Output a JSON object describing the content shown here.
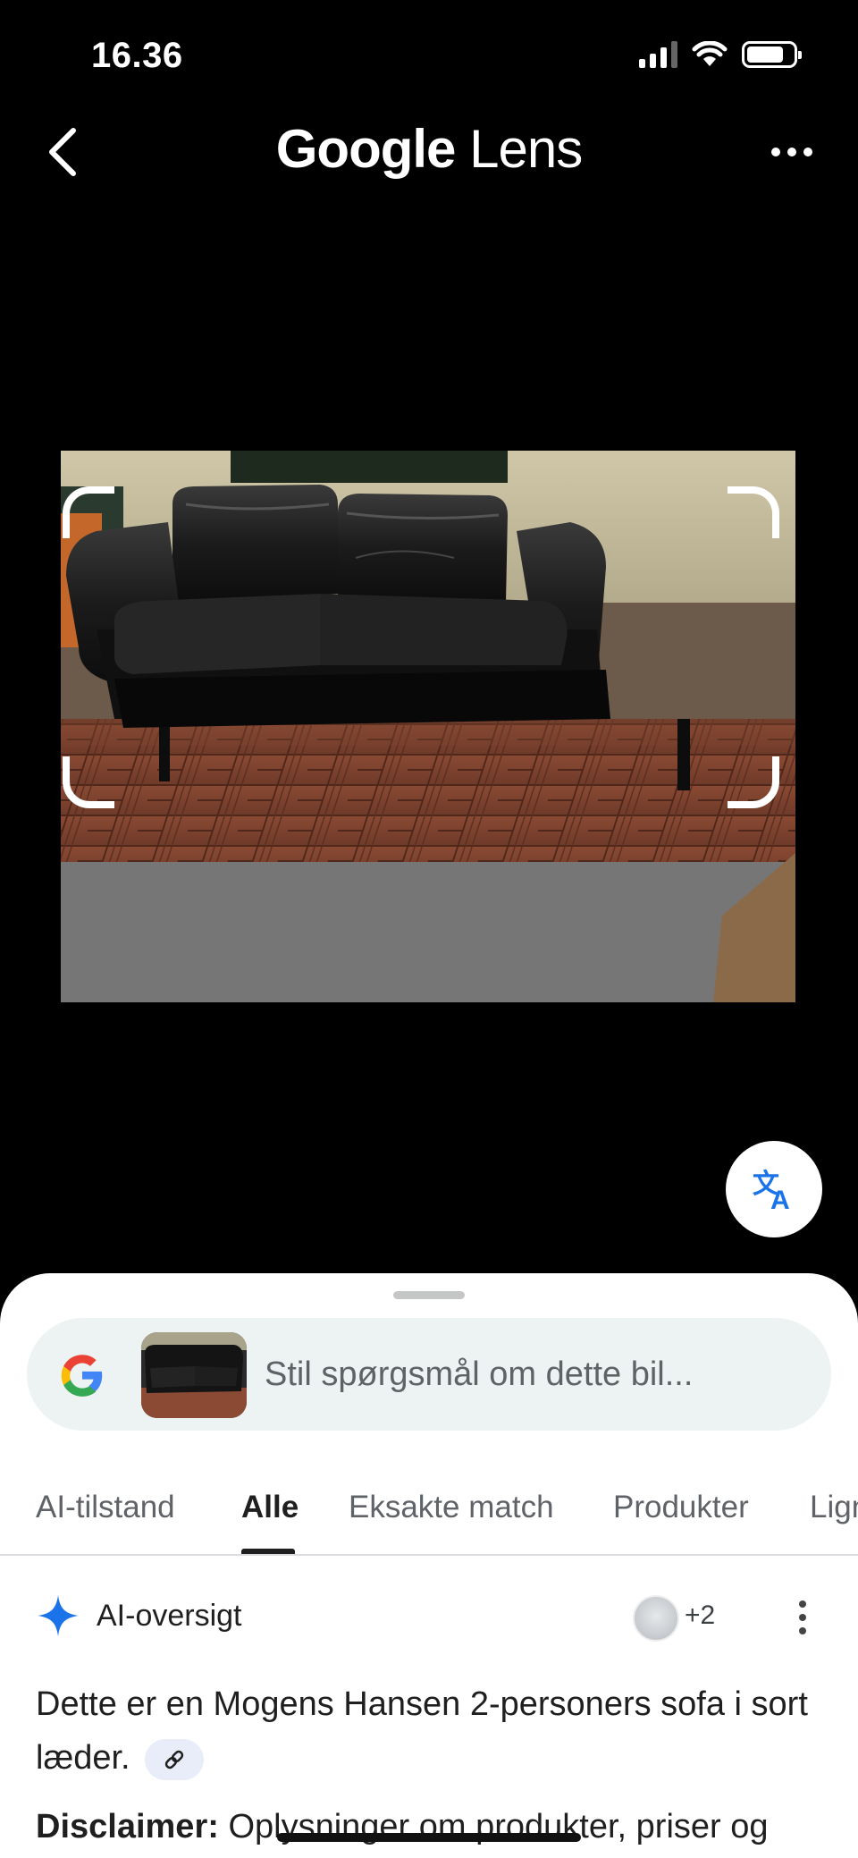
{
  "status_bar": {
    "time": "16.36"
  },
  "header": {
    "title_google": "Google",
    "title_lens": " Lens"
  },
  "icons": {
    "back": "chevron-left-icon",
    "more": "more-horizontal-icon",
    "translate": "translate-icon",
    "ai": "sparkle-icon",
    "link": "link-icon"
  },
  "search": {
    "placeholder": "Stil spørgsmål om dette bil..."
  },
  "tabs": [
    {
      "label": "AI-tilstand"
    },
    {
      "label": "Alle",
      "active": true
    },
    {
      "label": "Eksakte match"
    },
    {
      "label": "Produkter"
    },
    {
      "label": "Lign"
    }
  ],
  "ai_overview": {
    "title": "AI-oversigt",
    "source_count": "+2",
    "answer": "Dette er en Mogens Hansen 2-personers sofa i sort læder.",
    "disclaimer_label": "Disclaimer:",
    "disclaimer_text": " Oplysninger om produkter, priser og"
  },
  "colors": {
    "background": "#000000",
    "sheet": "#ffffff",
    "search_bg": "#edf2f2",
    "accent_blue": "#1a73e8"
  }
}
